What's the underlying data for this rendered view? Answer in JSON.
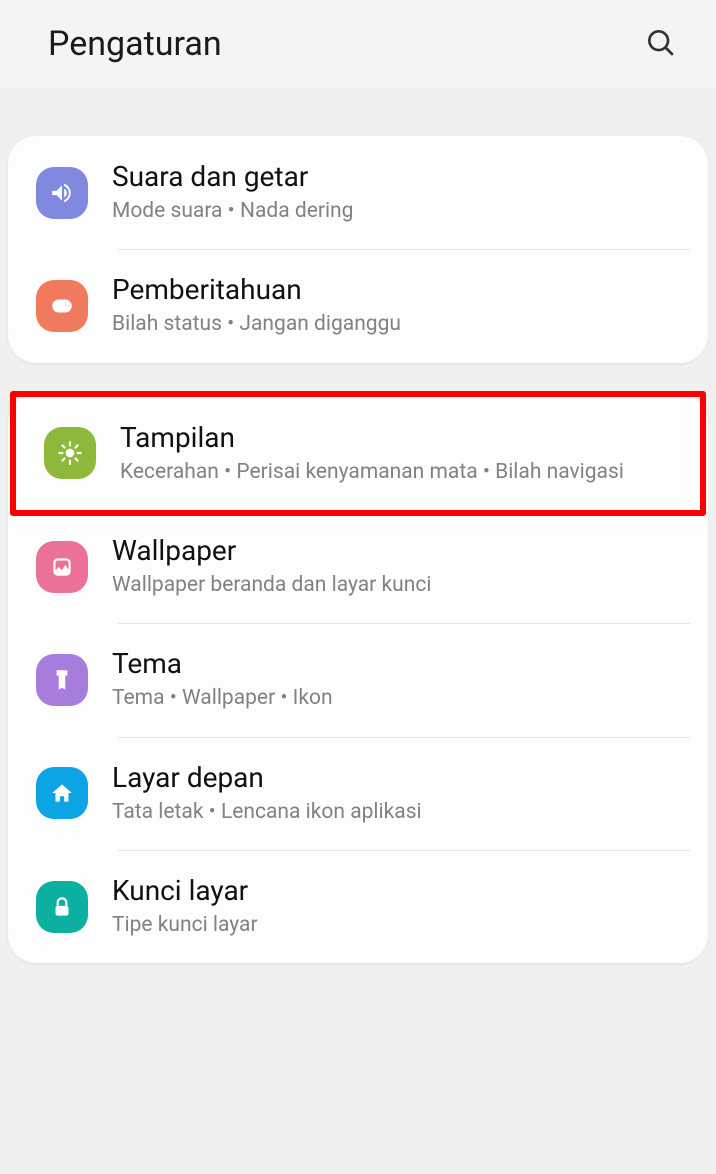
{
  "header": {
    "title": "Pengaturan"
  },
  "groups": [
    {
      "items": [
        {
          "title": "Suara dan getar",
          "subtitle": "Mode suara  •  Nada dering"
        },
        {
          "title": "Pemberitahuan",
          "subtitle": "Bilah status  •  Jangan diganggu"
        }
      ]
    },
    {
      "items": [
        {
          "title": "Tampilan",
          "subtitle": "Kecerahan  •  Perisai kenyamanan mata  •  Bilah navigasi"
        },
        {
          "title": "Wallpaper",
          "subtitle": "Wallpaper beranda dan layar kunci"
        },
        {
          "title": "Tema",
          "subtitle": "Tema  •  Wallpaper  •  Ikon"
        },
        {
          "title": "Layar depan",
          "subtitle": "Tata letak  •  Lencana ikon aplikasi"
        },
        {
          "title": "Kunci layar",
          "subtitle": "Tipe kunci layar"
        }
      ]
    }
  ]
}
